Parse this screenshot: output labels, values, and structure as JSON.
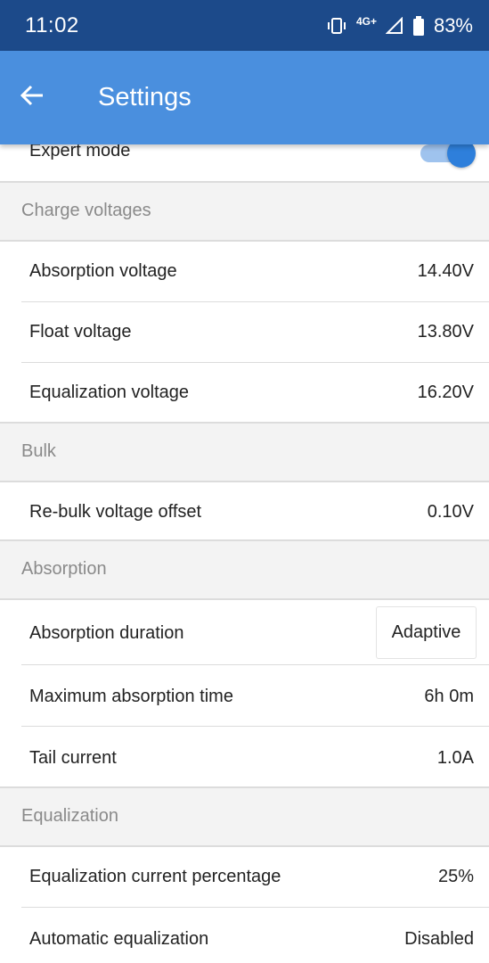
{
  "status_bar": {
    "time": "11:02",
    "network": "4G+",
    "battery": "83%"
  },
  "app_bar": {
    "title": "Settings",
    "back_icon": "arrow-back-icon"
  },
  "expert_mode": {
    "label": "Expert mode",
    "enabled": true
  },
  "sections": {
    "charge_voltages": {
      "header": "Charge voltages",
      "absorption_voltage": {
        "label": "Absorption voltage",
        "value": "14.40V"
      },
      "float_voltage": {
        "label": "Float voltage",
        "value": "13.80V"
      },
      "equalization_voltage": {
        "label": "Equalization voltage",
        "value": "16.20V"
      }
    },
    "bulk": {
      "header": "Bulk",
      "rebulk_offset": {
        "label": "Re-bulk voltage offset",
        "value": "0.10V"
      }
    },
    "absorption": {
      "header": "Absorption",
      "absorption_duration": {
        "label": "Absorption duration",
        "value": "Adaptive"
      },
      "max_absorption_time": {
        "label": "Maximum absorption time",
        "value": "6h 0m"
      },
      "tail_current": {
        "label": "Tail current",
        "value": "1.0A"
      }
    },
    "equalization": {
      "header": "Equalization",
      "current_percentage": {
        "label": "Equalization current percentage",
        "value": "25%"
      },
      "automatic_equalization": {
        "label": "Automatic equalization",
        "value": "Disabled"
      }
    }
  },
  "colors": {
    "status_bar": "#1c4a8a",
    "app_bar": "#4a8fde",
    "accent": "#2e7fdb",
    "section_bg": "#f3f3f3",
    "section_text": "#8a8a8a"
  }
}
